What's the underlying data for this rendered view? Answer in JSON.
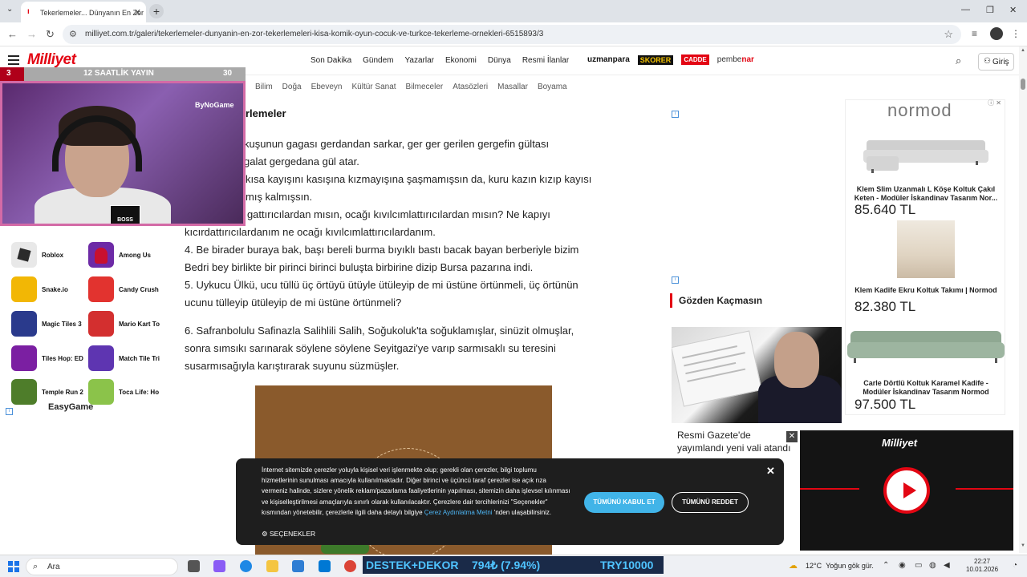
{
  "browser": {
    "tab_title": "Tekerlemeler... Dünyanın En Zor",
    "url": "milliyet.com.tr/galeri/tekerlemeler-dunyanin-en-zor-tekerlemeleri-kisa-komik-oyun-cocuk-ve-turkce-tekerleme-ornekleri-6515893/3"
  },
  "site": {
    "logo": "Milliyet",
    "nav": [
      "Son Dakika",
      "Gündem",
      "Yazarlar",
      "Ekonomi",
      "Dünya",
      "Resmi İlanlar"
    ],
    "partners": {
      "uzmanpara": "uzmanpara",
      "skorer": "SKORER",
      "cadde": "CADDE",
      "pembenar_a": "pembe",
      "pembenar_b": "nar"
    },
    "login": "Giriş",
    "subnav": [
      "Bilim",
      "Doğa",
      "Ebeveyn",
      "Kültür Sanat",
      "Bilmeceler",
      "Atasözleri",
      "Masallar",
      "Boyama"
    ]
  },
  "stream": {
    "rank": "3",
    "title": "12 SAATLİK YAYIN",
    "count": "30",
    "channel_badge": "ByNoGame",
    "clapper": "BOSS BEE"
  },
  "games": [
    {
      "label": "Roblox",
      "color": "#2b2b2b"
    },
    {
      "label": "Among Us",
      "color": "#c8102e"
    },
    {
      "label": "Snake.io",
      "color": "#f2b705"
    },
    {
      "label": "Candy Crush",
      "color": "#e2332f"
    },
    {
      "label": "Magic Tiles 3",
      "color": "#2a3a8c"
    },
    {
      "label": "Mario Kart To",
      "color": "#d32f2f"
    },
    {
      "label": "Tiles Hop: ED",
      "color": "#7b1fa2"
    },
    {
      "label": "Match Tile Tri",
      "color": "#5e35b1"
    },
    {
      "label": "Temple Run 2",
      "color": "#4e7d2a"
    },
    {
      "label": "Toca Life: Ho",
      "color": "#8bc34a"
    }
  ],
  "easygame": "EasyGame",
  "article": {
    "heading": "rlemeler",
    "lines": [
      "kuşunun gagası gerdandan sarkar, ger ger gerilen gergefin gültası",
      "galat gergedana gül atar.",
      "kısa kayışını kasışına kızmayışına şaşmamışsın da, kuru kazın kızıp kayısı",
      "mış kalmışsın.",
      "r gattırıcılardan mısın, ocağı kıvılcımlattırıcılardan mısın? Ne kapıyı",
      "kıcırdattırıcılardanım ne ocağı kıvılcımlattırıcılardanım.",
      "4. Be birader buraya bak, başı bereli burma bıyıklı bastı bacak bayan berberiyle bizim",
      "Bedri bey birlikte bir pirinci birinci buluşta birbirine dizip Bursa pazarına indi.",
      "5. Uykucu Ülkü, ucu tüllü üç örtüyü ütüyle ütüleyip de mi üstüne örtünmeli, üç örtünün",
      "ucunu tülleyip ütüleyip de mi üstüne örtünmeli?",
      "6. Safranbolulu Safinazla Salihlili Salih, Soğukoluk'ta soğuklamışlar, sinüzit olmuşlar,",
      "sonra sımsıkı sarınarak söylene söylene Seyitgazi'ye varıp sarmısaklı su teresini",
      "susarmısağıyla karıştırarak suyunu süzmüşler."
    ]
  },
  "sidebar": {
    "gozden": "Gözden Kaçmasın",
    "news_title": "Resmi Gazete'de yayımlandı yeni vali atandı"
  },
  "ads": {
    "brand": "normod",
    "items": [
      {
        "name": "Klem Slim Uzanmalı L Köşe Koltuk Çakıl Keten - Modüler İskandinav Tasarım Nor...",
        "price": "85.640 TL"
      },
      {
        "name": "Klem Kadife Ekru Koltuk Takımı | Normod",
        "price": "82.380 TL"
      },
      {
        "name": "Carle Dörtlü Koltuk Karamel Kadife - Modüler İskandinav Tasarım Normod",
        "price": "97.500 TL"
      }
    ]
  },
  "video": {
    "logo": "Milliyet"
  },
  "cookie": {
    "text": "İnternet sitemizde çerezler yoluyla kişisel veri işlenmekte olup; gerekli olan çerezler, bilgi toplumu hizmetlerinin sunulması amacıyla kullanılmaktadır. Diğer birinci ve üçüncü taraf çerezler ise açık rıza vermeniz halinde, sizlere yönelik reklam/pazarlama faaliyetlerinin yapılması, sitemizin daha işlevsel kılınması ve kişiselleştirilmesi amaçlarıyla sınırlı olarak kullanılacaktır. Çerezlere dair tercihlerinizi \"Seçenekler\" kısmından yönetebilir, çerezlerle ilgili daha detaylı bilgiye",
    "link": "Çerez Aydınlatma Metni",
    "text_end": "'nden ulaşabilirsiniz.",
    "options": "SEÇENEKLER",
    "accept": "TÜMÜNÜ KABUL ET",
    "reject": "TÜMÜNÜ REDDET"
  },
  "taskbar": {
    "search": "Ara",
    "ticker_a": "DESTEK+DEKOR",
    "ticker_b": "794₺ (7.94%)",
    "ticker_c": "TRY10000",
    "temp": "12°C",
    "weather": "Yoğun gök gür.",
    "time": "22:27",
    "date": "10.01.2026"
  },
  "colors": {
    "brand": "#e30613",
    "cookie_accept": "#41b4e8",
    "banner_bg": "#1e1e1e"
  }
}
